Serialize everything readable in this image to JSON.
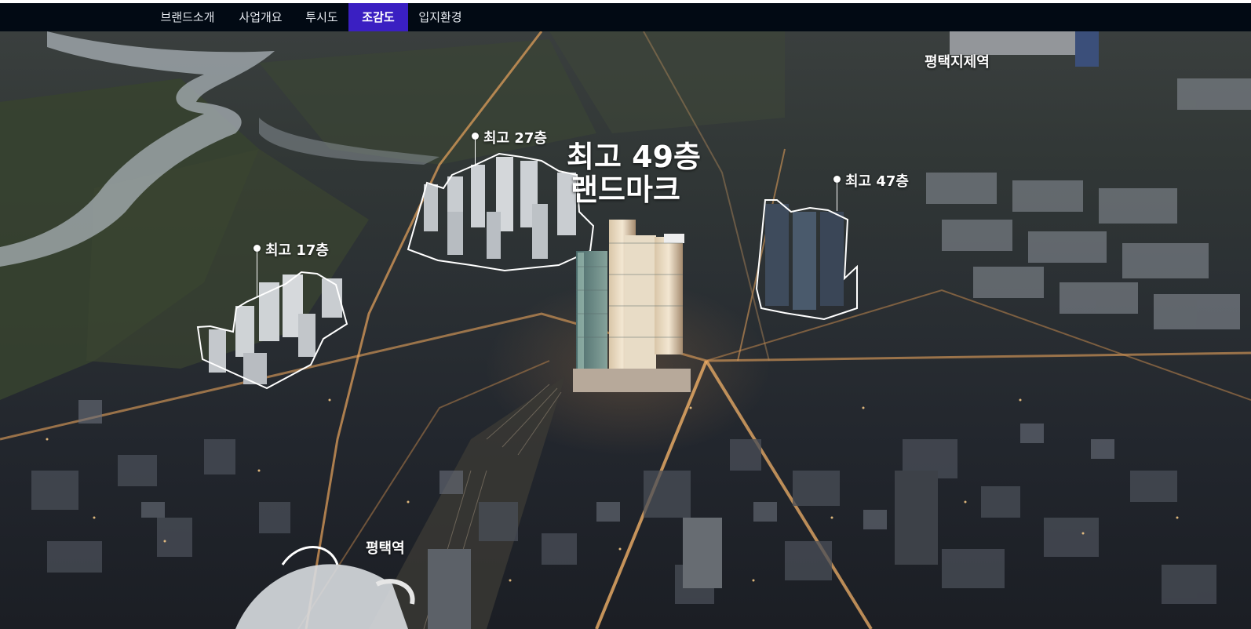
{
  "nav": {
    "items": [
      {
        "label": "브랜드소개"
      },
      {
        "label": "사업개요"
      },
      {
        "label": "투시도"
      },
      {
        "label": "조감도",
        "active": true
      },
      {
        "label": "입지환경"
      }
    ],
    "active_color": "#3a1fc2",
    "bar_color": "#020a14"
  },
  "map": {
    "main_title_line1": "최고 49층",
    "main_title_line2": "랜드마크",
    "labels": {
      "complex_27": "최고 27층",
      "complex_17": "최고 17층",
      "complex_47": "최고 47층",
      "station_pyeongtaek_jije": "평택지제역",
      "station_pyeongtaek": "평택역"
    },
    "outline_color": "#ffffff"
  }
}
